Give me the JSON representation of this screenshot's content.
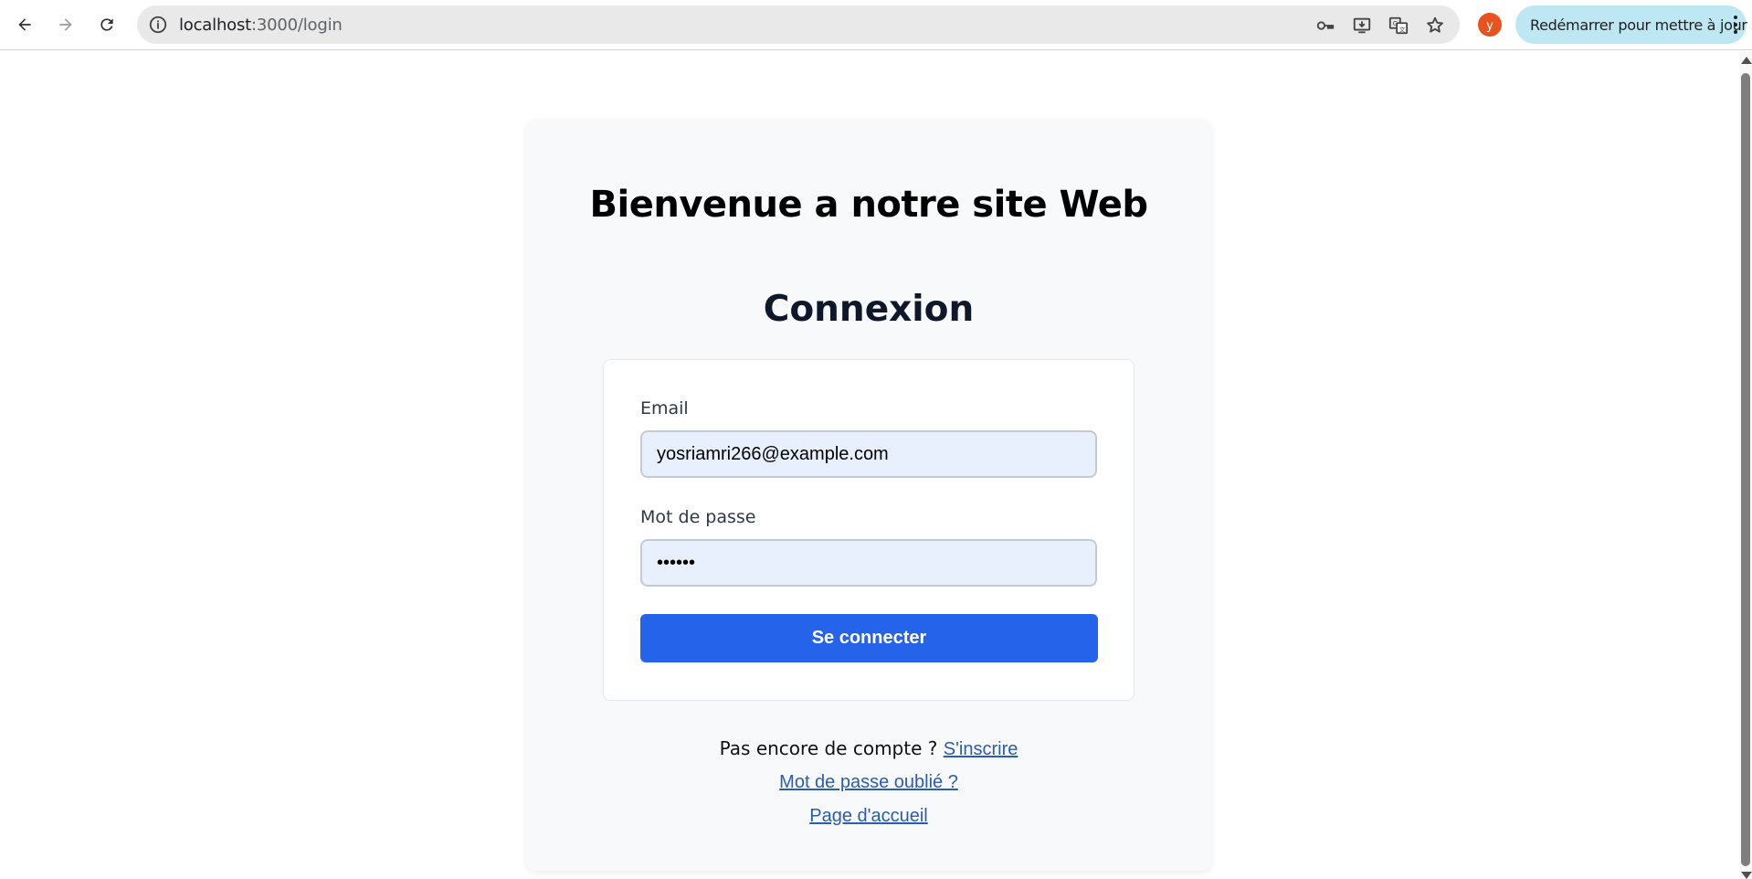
{
  "browser": {
    "url_host": "localhost",
    "url_path": ":3000/login",
    "profile_initial": "y",
    "update_label": "Redémarrer pour mettre à jour"
  },
  "page": {
    "site_title": "Bienvenue a notre site Web",
    "heading": "Connexion",
    "form": {
      "email_label": "Email",
      "email_value": "yosriamri266@example.com",
      "password_label": "Mot de passe",
      "password_value": "••••••",
      "submit_label": "Se connecter"
    },
    "footer": {
      "no_account_text": "Pas encore de compte ? ",
      "signup_link": "S'inscrire",
      "forgot_link": "Mot de passe oublié ?",
      "home_link": "Page d'accueil"
    }
  },
  "colors": {
    "primary_button": "#2563eb",
    "link": "#2a5db0",
    "avatar": "#e8521d",
    "update_pill": "#bde7f3"
  },
  "icons": [
    "back-arrow-icon",
    "forward-arrow-icon",
    "reload-icon",
    "info-icon",
    "password-key-icon",
    "install-app-icon",
    "translate-icon",
    "bookmark-star-icon",
    "more-vert-icon"
  ]
}
